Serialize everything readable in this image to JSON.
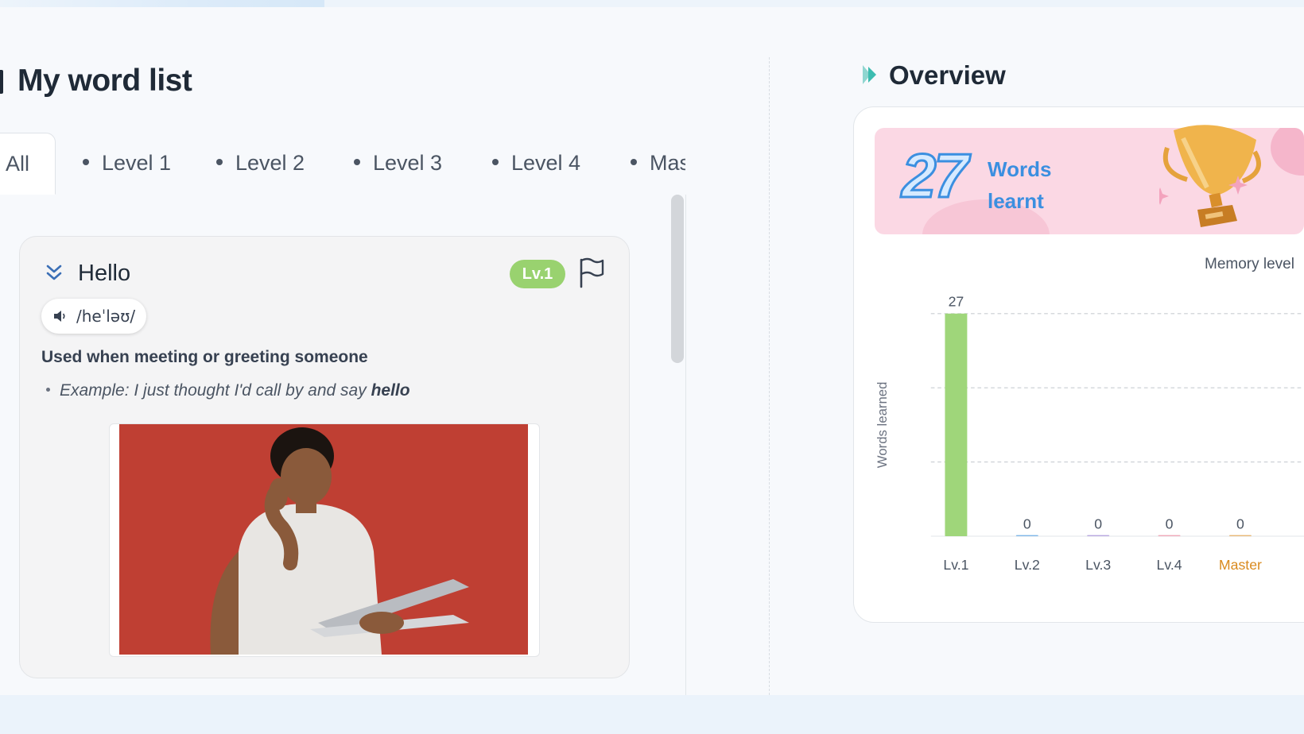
{
  "page_title": "My word list",
  "tabs": [
    {
      "label": "All",
      "active": true
    },
    {
      "label": "Level 1",
      "active": false
    },
    {
      "label": "Level 2",
      "active": false
    },
    {
      "label": "Level 3",
      "active": false
    },
    {
      "label": "Level 4",
      "active": false
    },
    {
      "label": "Master",
      "active": false
    }
  ],
  "word_card": {
    "word": "Hello",
    "level_badge": "Lv.1",
    "pronunciation": "/heˈləʊ/",
    "definition": "Used when meeting or greeting someone",
    "example_prefix": "Example: I just thought I'd call by and say ",
    "example_keyword": "hello",
    "image_alt": "man waving at laptop"
  },
  "overview": {
    "title": "Overview",
    "count": "27",
    "count_label": "Words learnt",
    "colors": {
      "banner": "#fbd8e4",
      "count_stroke": "#3b8fe0"
    }
  },
  "chart_data": {
    "type": "bar",
    "title": "Memory level",
    "ylabel": "Words learned",
    "xlabel": "",
    "categories": [
      "Lv.1",
      "Lv.2",
      "Lv.3",
      "Lv.4",
      "Master"
    ],
    "values": [
      27,
      0,
      0,
      0,
      0
    ],
    "ylim": [
      0,
      27
    ],
    "grid": true,
    "bar_colors": [
      "#9fd67a",
      "#7eb6e8",
      "#b9a7e0",
      "#f0a8b8",
      "#e8b774"
    ],
    "label_colors": [
      "#4b5563",
      "#4b5563",
      "#4b5563",
      "#4b5563",
      "#d98a1e"
    ]
  }
}
